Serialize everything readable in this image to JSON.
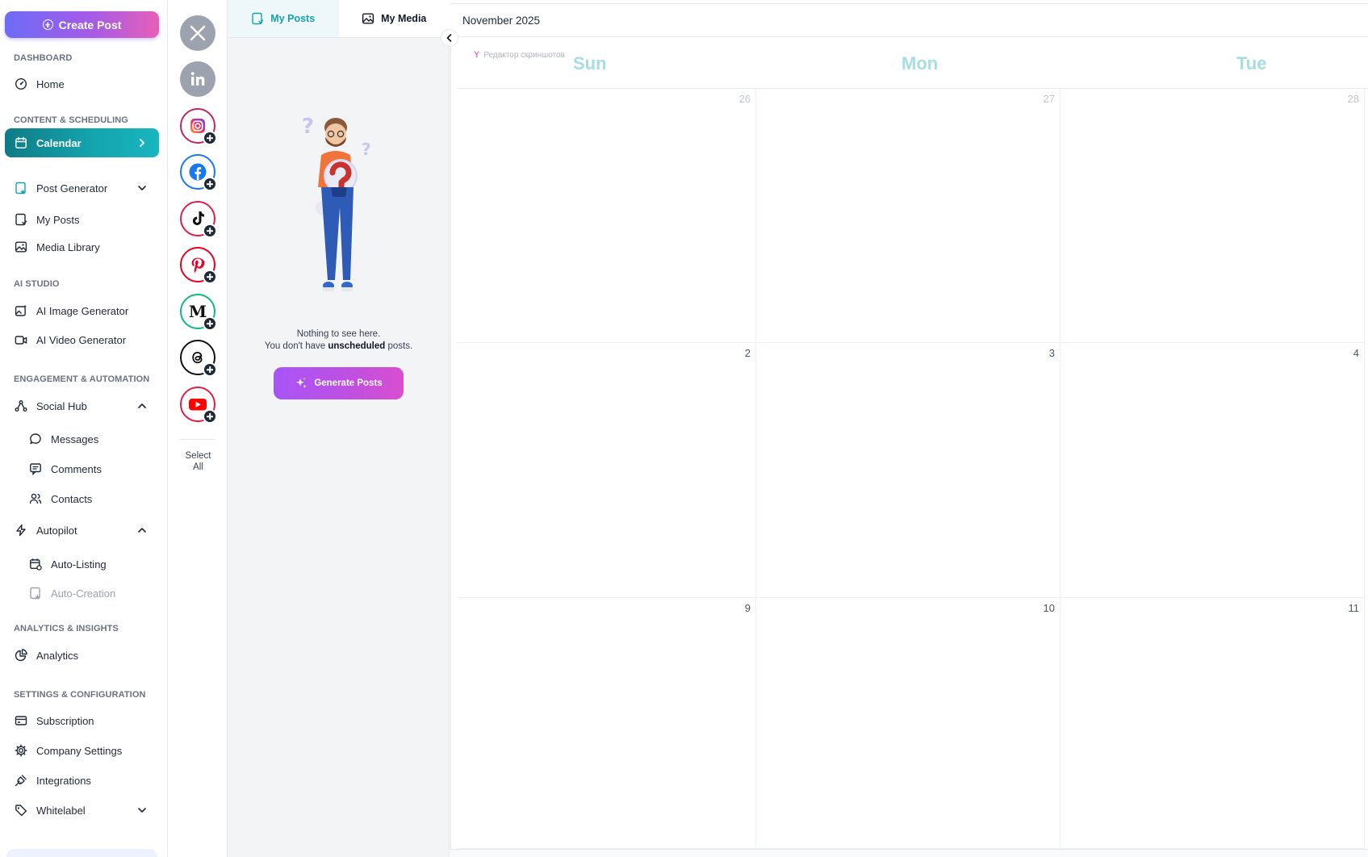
{
  "sidebar": {
    "create_post": "Create Post",
    "sections": {
      "dashboard": "DASHBOARD",
      "content": "CONTENT & SCHEDULING",
      "ai": "AI STUDIO",
      "engagement": "ENGAGEMENT & AUTOMATION",
      "analytics": "ANALYTICS & INSIGHTS",
      "settings": "SETTINGS & CONFIGURATION"
    },
    "items": {
      "home": "Home",
      "calendar": "Calendar",
      "post_generator": "Post Generator",
      "my_posts": "My Posts",
      "media_library": "Media Library",
      "ai_image": "AI Image Generator",
      "ai_video": "AI Video Generator",
      "social_hub": "Social Hub",
      "messages": "Messages",
      "comments": "Comments",
      "contacts": "Contacts",
      "autopilot": "Autopilot",
      "auto_listing": "Auto-Listing",
      "auto_creation": "Auto-Creation",
      "analytics": "Analytics",
      "subscription": "Subscription",
      "company_settings": "Company Settings",
      "integrations": "Integrations",
      "whitelabel": "Whitelabel"
    },
    "accent": "#14a3ad"
  },
  "social": {
    "accounts": [
      {
        "name": "x-icon",
        "connected": true
      },
      {
        "name": "linkedin-icon",
        "connected": true
      },
      {
        "name": "instagram-icon",
        "connected": false
      },
      {
        "name": "facebook-icon",
        "connected": false
      },
      {
        "name": "tiktok-icon",
        "connected": false
      },
      {
        "name": "pinterest-icon",
        "connected": false
      },
      {
        "name": "medium-icon",
        "connected": false
      },
      {
        "name": "threads-icon",
        "connected": false
      },
      {
        "name": "youtube-icon",
        "connected": false
      }
    ],
    "select_all": "Select All"
  },
  "posts_panel": {
    "tabs": [
      "My Posts",
      "My Media"
    ],
    "empty_line1": "Nothing to see here.",
    "empty_line2_pre": "You don't have ",
    "empty_line2_bold": "unscheduled",
    "empty_line2_post": " posts.",
    "generate_button": "Generate Posts"
  },
  "calendar": {
    "month": "November 2025",
    "days_of_week": [
      "Sun",
      "Mon",
      "Tue"
    ],
    "watermark": "Редактор скриншотов",
    "weeks": [
      [
        {
          "d": "26",
          "muted": true
        },
        {
          "d": "27",
          "muted": true
        },
        {
          "d": "28",
          "muted": true
        }
      ],
      [
        {
          "d": "2",
          "muted": false
        },
        {
          "d": "3",
          "muted": false
        },
        {
          "d": "4",
          "muted": false
        }
      ],
      [
        {
          "d": "9",
          "muted": false
        },
        {
          "d": "10",
          "muted": false
        },
        {
          "d": "11",
          "muted": false
        }
      ]
    ]
  }
}
